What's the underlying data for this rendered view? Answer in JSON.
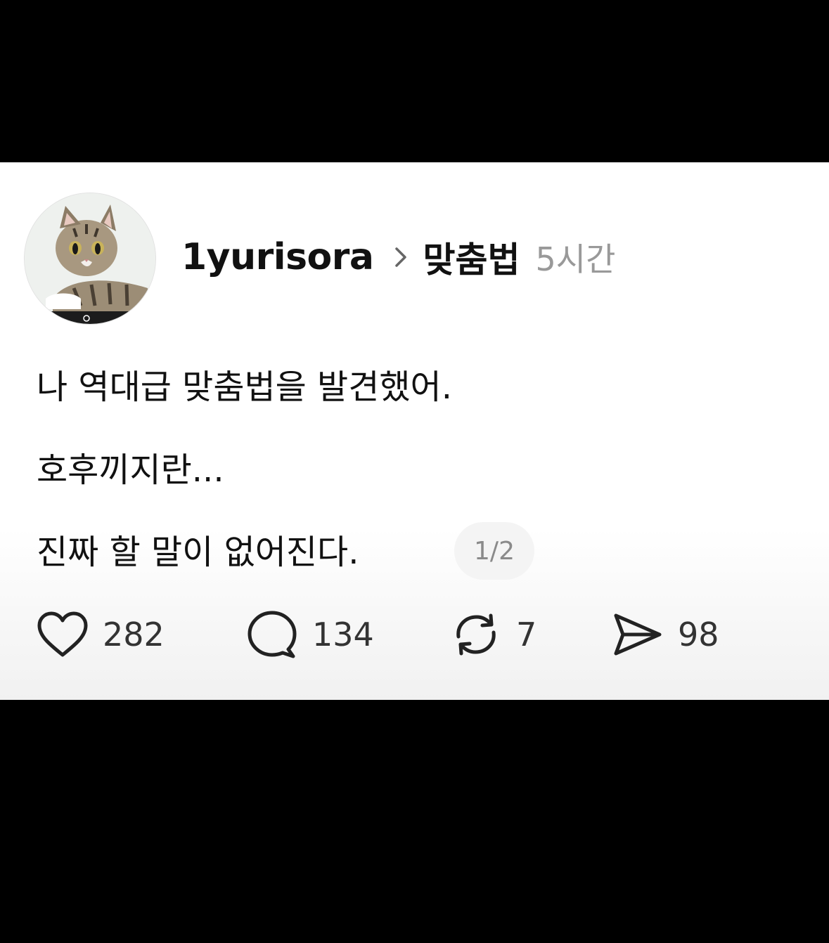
{
  "post": {
    "username": "1yurisora",
    "topic": "맞춤법",
    "time": "5시간",
    "lines": [
      "나 역대급 맞춤법을 발견했어.",
      "호후끼지란...",
      "진짜 할 말이 없어진다."
    ],
    "page_indicator": "1/2"
  },
  "actions": {
    "likes": "282",
    "comments": "134",
    "reposts": "7",
    "shares": "98"
  },
  "icons": {
    "avatar": "cat-photo-avatar",
    "separator": "chevron-right-icon",
    "like": "heart-icon",
    "comment": "speech-bubble-icon",
    "repost": "repost-icon",
    "share": "send-icon"
  },
  "colors": {
    "text": "#111111",
    "muted": "#999999",
    "background": "#ffffff",
    "letterbox": "#000000"
  }
}
